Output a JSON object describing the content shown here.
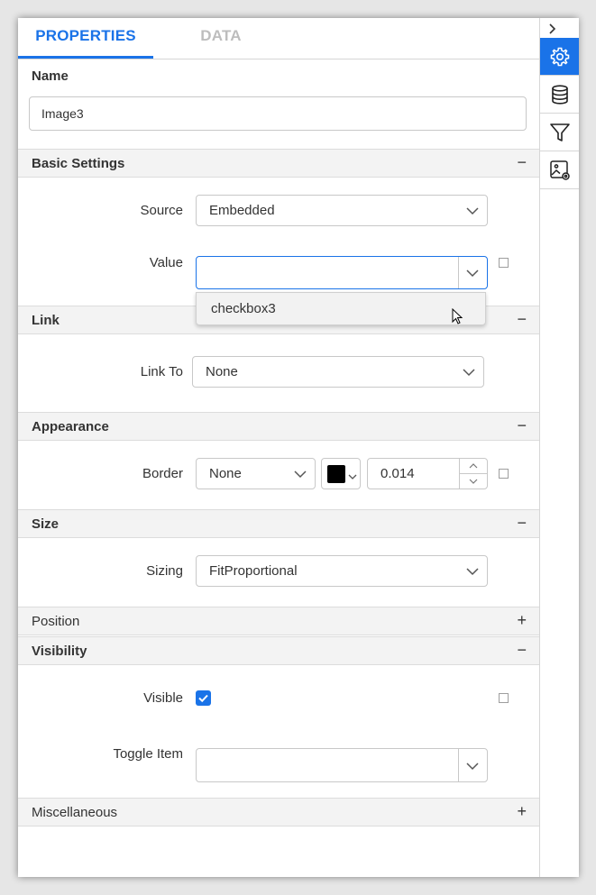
{
  "tabs": {
    "properties": "PROPERTIES",
    "data": "DATA"
  },
  "name": {
    "label": "Name",
    "value": "Image3"
  },
  "sections": {
    "basic": {
      "title": "Basic Settings",
      "toggle": "−"
    },
    "link": {
      "title": "Link",
      "toggle": "−"
    },
    "appearance": {
      "title": "Appearance",
      "toggle": "−"
    },
    "size": {
      "title": "Size",
      "toggle": "−"
    },
    "position": {
      "title": "Position",
      "toggle": "+"
    },
    "visibility": {
      "title": "Visibility",
      "toggle": "−"
    },
    "misc": {
      "title": "Miscellaneous",
      "toggle": "+"
    }
  },
  "basic": {
    "source_label": "Source",
    "source_value": "Embedded",
    "value_label": "Value",
    "value_value": "",
    "dropdown_option": "checkbox3"
  },
  "link": {
    "link_to_label": "Link To",
    "link_to_value": "None"
  },
  "appearance": {
    "border_label": "Border",
    "border_style": "None",
    "border_color": "#000000",
    "border_width": "0.014"
  },
  "size": {
    "sizing_label": "Sizing",
    "sizing_value": "FitProportional"
  },
  "visibility": {
    "visible_label": "Visible",
    "visible_checked": true,
    "toggle_item_label": "Toggle Item",
    "toggle_item_value": ""
  },
  "sidebar": {
    "icons": [
      "chevron-right-icon",
      "gear-icon",
      "database-icon",
      "filter-icon",
      "image-settings-icon"
    ],
    "accent": "#1a73e8"
  }
}
